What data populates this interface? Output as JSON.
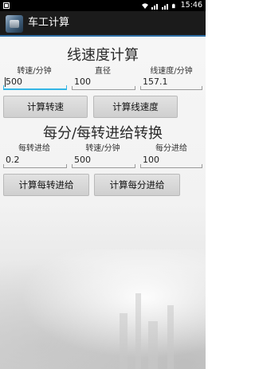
{
  "status_bar": {
    "time": "15:46",
    "icons": [
      "notification-icon",
      "wifi-icon",
      "signal-icon",
      "signal-icon",
      "battery-icon"
    ]
  },
  "app": {
    "title": "车工计算"
  },
  "linear_speed_section": {
    "title": "线速度计算",
    "labels": {
      "speed": "转速/分钟",
      "diameter": "直径",
      "linear_speed": "线速度/分钟"
    },
    "values": {
      "speed": "500",
      "diameter": "100",
      "linear_speed": "157.1"
    },
    "buttons": {
      "calc_speed": "计算转速",
      "calc_linear_speed": "计算线速度"
    }
  },
  "feed_section": {
    "title": "每分/每转进给转换",
    "labels": {
      "feed_per_rev": "每转进给",
      "speed": "转速/分钟",
      "feed_per_min": "每分进给"
    },
    "values": {
      "feed_per_rev": "0.2",
      "speed": "500",
      "feed_per_min": "100"
    },
    "buttons": {
      "calc_feed_per_rev": "计算每转进给",
      "calc_feed_per_min": "计算每分进给"
    }
  },
  "colors": {
    "status_bar": "#000000",
    "title_bar": "#1b1b1b",
    "title_underline": "#2f6fa6",
    "focus_accent": "#33b5e5"
  }
}
